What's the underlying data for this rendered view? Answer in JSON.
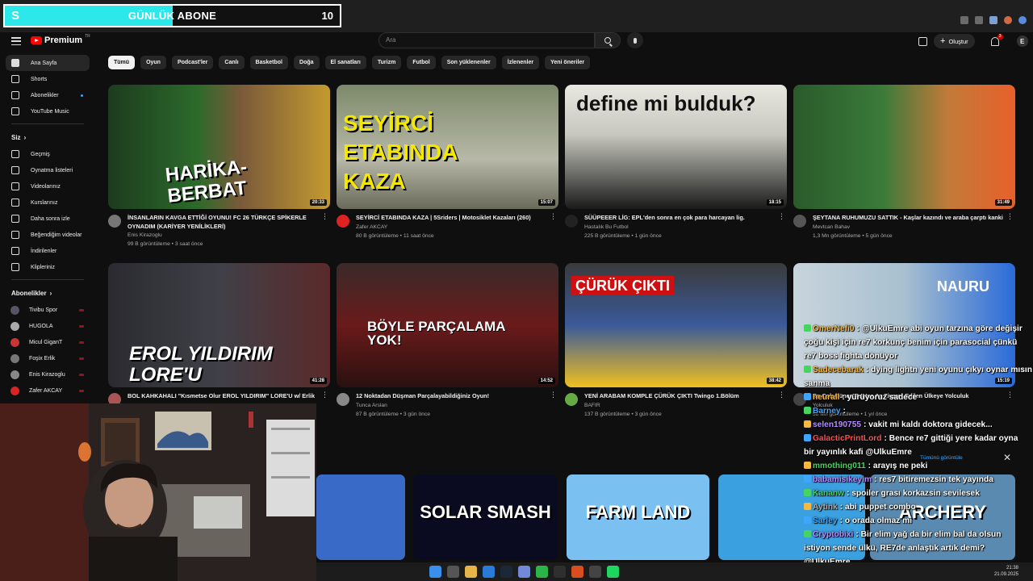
{
  "overlay": {
    "letter": "S",
    "title": "GÜNLÜK ABONE",
    "count": "10",
    "fill_fraction": 0.5
  },
  "header": {
    "logo": "Premium",
    "logo_sup": "TR",
    "search_placeholder": "Ara",
    "create_label": "Oluştur",
    "notif_count": "3"
  },
  "sidebar": {
    "main": [
      {
        "label": "Ana Sayfa",
        "icon": "home-icon",
        "active": true
      },
      {
        "label": "Shorts",
        "icon": "shorts-icon"
      },
      {
        "label": "Abonelikler",
        "icon": "subscriptions-icon",
        "dot": true
      },
      {
        "label": "YouTube Music",
        "icon": "music-icon"
      }
    ],
    "you_header": "Siz",
    "you": [
      {
        "label": "Geçmiş",
        "icon": "history-icon"
      },
      {
        "label": "Oynatma listeleri",
        "icon": "playlist-icon"
      },
      {
        "label": "Videolarınız",
        "icon": "video-icon"
      },
      {
        "label": "Kurslarınız",
        "icon": "course-icon"
      },
      {
        "label": "Daha sonra izle",
        "icon": "clock-icon"
      },
      {
        "label": "Beğendiğim videolar",
        "icon": "like-icon"
      },
      {
        "label": "İndirilenler",
        "icon": "download-icon"
      },
      {
        "label": "Klipleriniz",
        "icon": "clip-icon"
      }
    ],
    "subs_header": "Abonelikler",
    "subs": [
      {
        "label": "Tivibu Spor",
        "color": "#556",
        "live": true
      },
      {
        "label": "HUGOLA",
        "color": "#aaa",
        "live": true
      },
      {
        "label": "Micul GiganT",
        "color": "#c33",
        "live": true
      },
      {
        "label": "Foşix Erlik",
        "color": "#777",
        "live": true
      },
      {
        "label": "Enis Kirazoglu",
        "color": "#888",
        "live": true
      },
      {
        "label": "Zafer AKCAY",
        "color": "#d22",
        "live": true
      }
    ]
  },
  "chips": [
    "Tümü",
    "Oyun",
    "Podcast'ler",
    "Canlı",
    "Basketbol",
    "Doğa",
    "El sanatları",
    "Turizm",
    "Futbol",
    "Son yüklenenler",
    "İzlenenler",
    "Yeni öneriler"
  ],
  "videos": [
    {
      "title": "İNSANLARIN KAVGA ETTİĞİ OYUNU! FC 26 TÜRKÇE SPİKERLE OYNADIM (KARİYER YENİLİKLERİ)",
      "channel": "Enis Kirazoglu",
      "stats": "99 B görüntüleme • 3 saat önce",
      "duration": "20:33",
      "thumb_text": "HARİKA-BERBAT"
    },
    {
      "title": "SEYİRCİ ETABINDA KAZA | 5Sriders | Motosiklet Kazaları (260)",
      "channel": "Zafer AKCAY",
      "stats": "80 B görüntüleme • 11 saat önce",
      "duration": "15:07",
      "thumb_text": "SEYİRCİ ETABINDA KAZA"
    },
    {
      "title": "SÜÜPEEER LİG: EPL'den sonra en çok para harcayan lig.",
      "channel": "Hastalık Bu Futbol",
      "stats": "225 B görüntüleme • 1 gün önce",
      "duration": "18:15",
      "thumb_text": "define mi bulduk?"
    },
    {
      "title": "ŞEYTANA RUHUMUZU SATTIK - Kaşlar kazındı ve araba çarptı kanki",
      "channel": "Mevtcan Bahav",
      "stats": "1,3 Mn görüntüleme • 5 gün önce",
      "duration": "31:49",
      "thumb_text": ""
    },
    {
      "title": "BOL KAHKAHALI \"Kısmetse Olur EROL YILDIRIM\" LORE'U w/ Erlik",
      "channel": "",
      "stats": "",
      "duration": "41:28",
      "thumb_text": "EROL YILDIRIM LORE'U"
    },
    {
      "title": "12 Noktadan Düşman Parçalayabildiğiniz Oyun!",
      "channel": "Tunca Arslan",
      "stats": "87 B görüntüleme • 3 gün önce",
      "duration": "14:52",
      "thumb_text": "BÖYLE PARÇALAMA YOK!"
    },
    {
      "title": "YENİ ARABAM KOMPLE ÇÜRÜK ÇIKTI Twingo 1.Bölüm",
      "channel": "BAFIR",
      "stats": "137 B görüntüleme • 3 gün önce",
      "duration": "38:42",
      "thumb_text": "ÇÜRÜK ÇIKTI"
    },
    {
      "title": "En Çok Güneş Ren'ye Az Ziyaret Edilen Ülkeye Yolculuk",
      "channel": "Yolculuk",
      "stats": "58 Mn görüntüleme • 1 yıl önce",
      "duration": "15:19",
      "thumb_text": "NAURU"
    }
  ],
  "games": [
    "",
    "SOLAR SMASH",
    "FARM LAND",
    "",
    "ARCHERY"
  ],
  "chat": [
    {
      "name": "OmerNefi0",
      "color": "#f5b942",
      "msg": "@UlkuEmre abi oyun tarzına göre değişir"
    },
    {
      "name": "",
      "color": "#fff",
      "msg": "çoğu kişi için re7 korkunç benim için parasocial çünkü"
    },
    {
      "name": "",
      "color": "#fff",
      "msg": "re7 boss fighta dönüyor"
    },
    {
      "name": "Sadecebarak",
      "color": "#f5b942",
      "msg": "dying lightn yeni oyunu çıkyı oynar mısın"
    },
    {
      "name": "",
      "color": "#fff",
      "msg": "sanma"
    },
    {
      "name": "neurall",
      "color": "#f5b942",
      "msg": "yürüyoruz sadece"
    },
    {
      "name": "Barney",
      "color": "#3ea6ff",
      "msg": ""
    },
    {
      "name": "selen190755",
      "color": "#b58cff",
      "msg": "vakit mi kaldı doktora gidecek..."
    },
    {
      "name": "GalacticPrintLord",
      "color": "#ff4d4d",
      "msg": "Bence re7 gittiği yere kadar oyna"
    },
    {
      "name": "",
      "color": "#fff",
      "msg": "bir yayınlık kafi @UlkuEmre"
    },
    {
      "name": "mmothing011",
      "color": "#45d45f",
      "msg": "arayış ne peki"
    },
    {
      "name": "babamisikeyim",
      "color": "#b58cff",
      "msg": "res7 bitiremezsin tek yayında"
    },
    {
      "name": "Kananw",
      "color": "#45d45f",
      "msg": "spoiler grası korkazsin sevilesek"
    },
    {
      "name": "Aytink",
      "color": "#aaa",
      "msg": "abi puppet combo"
    },
    {
      "name": "Sarley",
      "color": "#3ea6ff",
      "msg": "o orada olmaz mi"
    },
    {
      "name": "Cryptobixi",
      "color": "#b58cff",
      "msg": "Bir elim yağ da bir elim bal da olsun"
    },
    {
      "name": "",
      "color": "#fff",
      "msg": "istiyon sende ülkü, RE7de anlaştık artık demi?"
    },
    {
      "name": "",
      "color": "#fff",
      "msg": "@UlkuEmre"
    }
  ],
  "popup": {
    "label": "Tümünü görüntüle"
  },
  "taskbar": {
    "time": "21:38",
    "date": "21.09.2025"
  }
}
